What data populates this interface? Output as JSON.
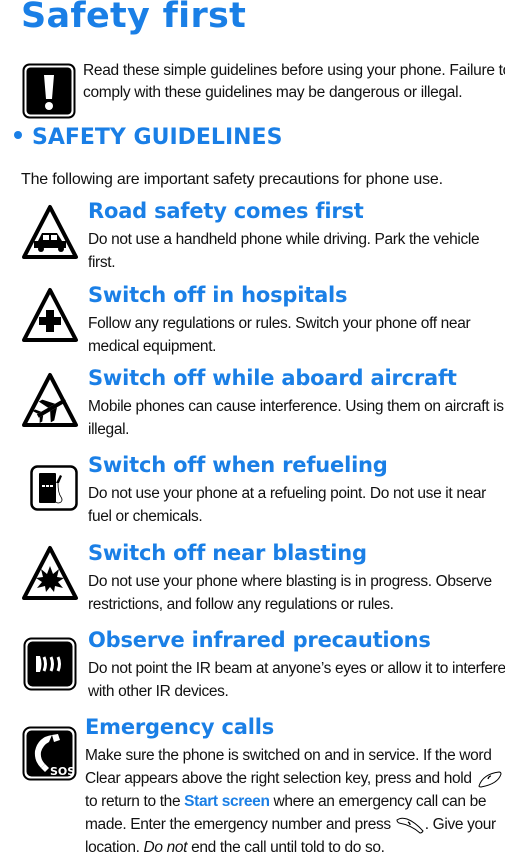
{
  "page": {
    "title": "Safety first",
    "intro": "Read these simple guidelines before using your phone. Failure to comply with these guidelines may be dangerous or illegal.",
    "intro_icon": "warning-exclamation-icon",
    "section_heading": "SAFETY GUIDELINES",
    "lead": "The following are important safety precautions for phone use.",
    "accent_color": "#1a7fe6"
  },
  "items": [
    {
      "icon": "car-triangle-icon",
      "heading": "Road safety comes first",
      "body": "Do not use a handheld phone while driving. Park the vehicle first."
    },
    {
      "icon": "hospital-cross-triangle-icon",
      "heading": "Switch off in hospitals",
      "body": "Follow any regulations or rules. Switch your phone off near medical equipment."
    },
    {
      "icon": "aircraft-triangle-icon",
      "heading": "Switch off while aboard aircraft",
      "body": "Mobile phones can cause interference. Using them on aircraft is illegal."
    },
    {
      "icon": "fuel-pump-icon",
      "heading": "Switch off when refueling",
      "body": "Do not use your phone at a refueling point. Do not use it near fuel or chemicals."
    },
    {
      "icon": "blasting-triangle-icon",
      "heading": "Switch off near blasting",
      "body": "Do not use your phone where blasting is in progress. Observe restrictions, and follow any regulations or rules."
    },
    {
      "icon": "infrared-icon",
      "heading": "Observe infrared precautions",
      "body": "Do not point the IR beam at anyone’s eyes or allow it to interfere with other IR devices."
    },
    {
      "icon": "sos-phone-icon",
      "heading": "Emergency calls",
      "body_parts": {
        "p1": "Make sure the phone is switched on and in service. If the word Clear appears above the right selection key, press and hold",
        "p2": " to return to the ",
        "link": "Start screen",
        "p3": " where an emergency call can be made. Enter the emergency number and press ",
        "p4": ". Give your location. ",
        "emphasis": "Do not",
        "p5": " end the call until told to do so."
      },
      "end_key_icon": "end-key-icon",
      "call_key_icon": "call-key-icon"
    }
  ]
}
